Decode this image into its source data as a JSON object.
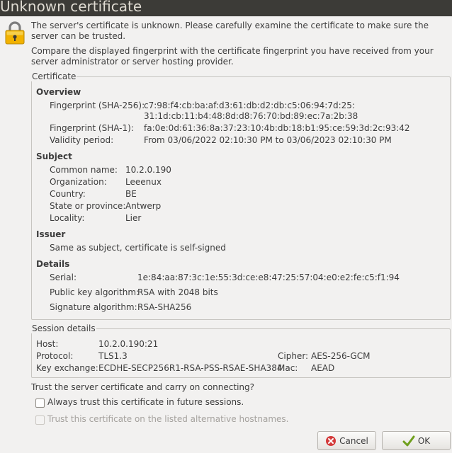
{
  "dialog": {
    "title": "Unknown certificate",
    "intro_line1": "The server's certificate is unknown. Please carefully examine the certificate to make sure the server can be trusted.",
    "intro_line2": "Compare the displayed fingerprint with the certificate fingerprint you have received from your server administrator or server hosting provider."
  },
  "certificate": {
    "group_label": "Certificate",
    "overview_heading": "Overview",
    "sha256_label": "Fingerprint (SHA-256):",
    "sha256_line1": "c7:98:f4:cb:ba:af:d3:61:db:d2:db:c5:06:94:7d:25:",
    "sha256_line2": "31:1d:cb:11:b4:48:8d:d8:76:70:bd:89:ec:7a:2b:38",
    "sha1_label": "Fingerprint (SHA-1):",
    "sha1_value": "fa:0e:0d:61:36:8a:37:23:10:4b:db:18:b1:95:ce:59:3d:2c:93:42",
    "validity_label": "Validity period:",
    "validity_value": "From 03/06/2022 02:10:30 PM to 03/06/2023 02:10:30 PM",
    "subject_heading": "Subject",
    "common_name_label": "Common name:",
    "common_name_value": "10.2.0.190",
    "organization_label": "Organization:",
    "organization_value": "Leeenux",
    "country_label": "Country:",
    "country_value": "BE",
    "state_label": "State or province:",
    "state_value": "Antwerp",
    "locality_label": "Locality:",
    "locality_value": "Lier",
    "issuer_heading": "Issuer",
    "issuer_value": "Same as subject, certificate is self-signed",
    "details_heading": "Details",
    "serial_label": "Serial:",
    "serial_value": "1e:84:aa:87:3c:1e:55:3d:ce:e8:47:25:57:04:e0:e2:fe:c5:f1:94",
    "pubkey_label": "Public key algorithm:",
    "pubkey_value": "RSA with 2048 bits",
    "sigalg_label": "Signature algorithm:",
    "sigalg_value": "RSA-SHA256"
  },
  "session": {
    "group_label": "Session details",
    "host_label": "Host:",
    "host_value": "10.2.0.190:21",
    "protocol_label": "Protocol:",
    "protocol_value": "TLS1.3",
    "cipher_label": "Cipher:",
    "cipher_value": "AES-256-GCM",
    "kex_label": "Key exchange:",
    "kex_value": "ECDHE-SECP256R1-RSA-PSS-RSAE-SHA384",
    "mac_label": "Mac:",
    "mac_value": "AEAD"
  },
  "trust": {
    "question": "Trust the server certificate and carry on connecting?",
    "always_trust_label": "Always trust this certificate in future sessions.",
    "always_trust_checked": false,
    "alt_hostnames_label": "Trust this certificate on the listed alternative hostnames.",
    "alt_hostnames_checked": false,
    "alt_hostnames_enabled": false
  },
  "buttons": {
    "cancel_label": "Cancel",
    "ok_label": "OK"
  },
  "icons": {
    "lock": "lock-icon",
    "cancel": "cancel-icon",
    "ok": "checkmark-icon"
  },
  "colors": {
    "titlebar": "#3c3b37",
    "lock_body": "#f2b200",
    "cancel_icon": "#d43a3a",
    "ok_icon": "#6f9f1d"
  }
}
